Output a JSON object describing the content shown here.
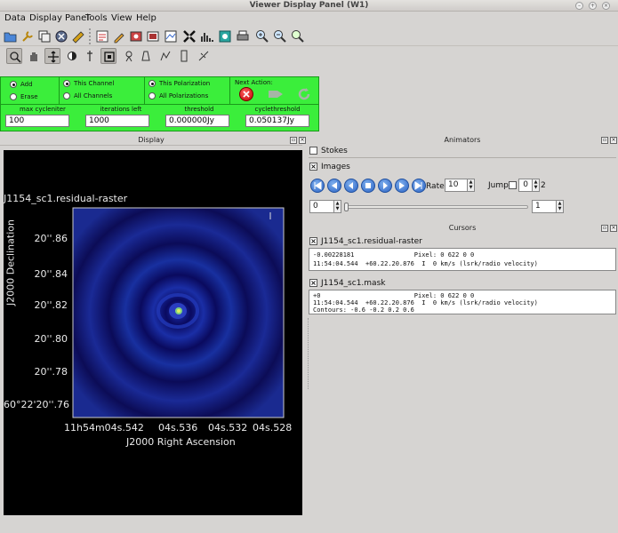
{
  "window": {
    "title": "Viewer Display Panel (W1)"
  },
  "menu": {
    "items": [
      "Data",
      "Display Panel",
      "Tools",
      "View",
      "Help"
    ]
  },
  "controls": {
    "add_label": "Add",
    "erase_label": "Erase",
    "this_channel": "This Channel",
    "all_channels": "All Channels",
    "this_polarization": "This Polarization",
    "all_polarizations": "All Polarizations",
    "next_action": "Next Action:",
    "fields": [
      {
        "label": "max cycleniter",
        "value": "100"
      },
      {
        "label": "iterations left",
        "value": "1000"
      },
      {
        "label": "threshold",
        "value": "0.000000Jy"
      },
      {
        "label": "cyclethreshold",
        "value": "0.050137Jy"
      }
    ]
  },
  "display": {
    "header": "Display",
    "image_title": "J1154_sc1.residual-raster",
    "y_ticks": [
      "20''.86",
      "20''.84",
      "20''.82",
      "20''.80",
      "20''.78",
      "60°22'20''.76"
    ],
    "x_ticks": [
      "11h54m04s.542",
      "04s.536",
      "04s.532",
      "04s.528"
    ],
    "x_label": "J2000 Right Ascension",
    "y_label": "J2000 Declination",
    "colors": {
      "background": "#000000",
      "image_dark": "#00004a",
      "image_ring": "#1a2ea6"
    }
  },
  "animators": {
    "header": "Animators",
    "stokes_label": "Stokes",
    "images_label": "Images",
    "rate_label": "Rate:",
    "rate_value": "10",
    "jump_label": "Jump",
    "jump_value": "0",
    "jump_max": "2",
    "frame_value": "0",
    "frame_end": "1"
  },
  "cursors": {
    "header": "Cursors",
    "items": [
      {
        "name": "J1154_sc1.residual-raster",
        "lines": [
          "-0.00228181                Pixel: 0 622 0 0",
          "11:54:04.544  +60.22.20.876  I  0 km/s (lsrk/radio velocity)"
        ]
      },
      {
        "name": "J1154_sc1.mask",
        "lines": [
          "+0                         Pixel: 0 622 0 0",
          "11:54:04.544  +60.22.20.876  I  0 km/s (lsrk/radio velocity)",
          "Contours: -0.6 -0.2 0.2 0.6"
        ]
      }
    ]
  },
  "icons": {
    "toolbar1": [
      "open-folder-icon",
      "wrench-icon",
      "new-panel-icon",
      "close-panel-icon",
      "options-icon",
      "data-manager-icon",
      "save-image-icon",
      "print-icon",
      "zoom-in-icon",
      "zoom-out-icon",
      "zoom-reset-icon"
    ],
    "toolbar2": [
      "zoom-tool-icon",
      "pan-tool-icon",
      "crosshair-tool-icon",
      "contrast-tool-icon",
      "rectangle-region-icon",
      "ellipse-region-icon",
      "polygon-region-icon",
      "polyline-tool-icon",
      "position-tool-icon",
      "ruler-tool-icon"
    ]
  }
}
